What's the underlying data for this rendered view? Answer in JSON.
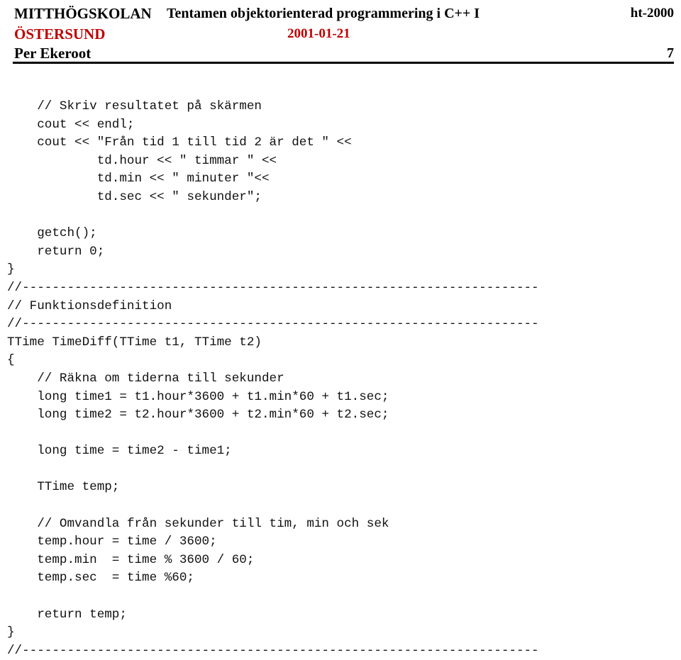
{
  "header": {
    "institution_line1": "MITTHÖGSKOLAN",
    "institution_line2": "ÖSTERSUND",
    "exam_title": "Tentamen objektorienterad programmering i C++ I",
    "term": "ht-2000",
    "date": "2001-01-21",
    "author": "Per Ekeroot",
    "page_number": "7",
    "rule_color": "#000000",
    "accent_color": "#c00000"
  },
  "code": {
    "language": "C++",
    "lines": [
      "    // Skriv resultatet på skärmen",
      "    cout << endl;",
      "    cout << \"Från tid 1 till tid 2 är det \" <<",
      "            td.hour << \" timmar \" <<",
      "            td.min << \" minuter \"<<",
      "            td.sec << \" sekunder\";",
      "",
      "    getch();",
      "    return 0;",
      "}",
      "//---------------------------------------------------------------------",
      "// Funktionsdefinition",
      "//---------------------------------------------------------------------",
      "TTime TimeDiff(TTime t1, TTime t2)",
      "{",
      "    // Räkna om tiderna till sekunder",
      "    long time1 = t1.hour*3600 + t1.min*60 + t1.sec;",
      "    long time2 = t2.hour*3600 + t2.min*60 + t2.sec;",
      "",
      "    long time = time2 - time1;",
      "",
      "    TTime temp;",
      "",
      "    // Omvandla från sekunder till tim, min och sek",
      "    temp.hour = time / 3600;",
      "    temp.min  = time % 3600 / 60;",
      "    temp.sec  = time %60;",
      "",
      "    return temp;",
      "}",
      "//---------------------------------------------------------------------"
    ]
  }
}
